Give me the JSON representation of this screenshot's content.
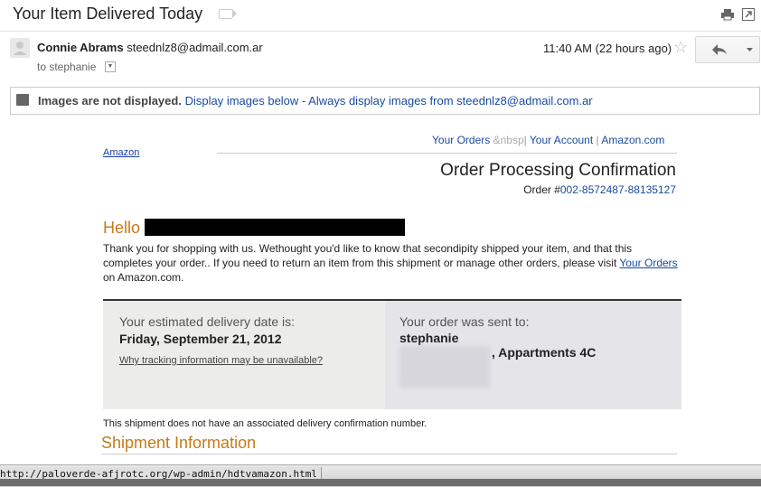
{
  "email": {
    "subject": "Your Item Delivered Today",
    "sender_name": "Connie Abrams",
    "sender_email": "steednlz8@admail.com.ar",
    "to_line": "to stephanie",
    "time": "11:40 AM (22 hours ago)"
  },
  "banner": {
    "bold": "Images are not displayed.",
    "link1": "Display images below",
    "sep": " - ",
    "link2": "Always display images from steednlz8@admail.com.ar"
  },
  "body": {
    "logo_text": "Amazon",
    "nav": {
      "your_orders": "Your Orders",
      "nbsp": "&nbsp",
      "your_account": "Your Account",
      "amazon_com": "Amazon.com"
    },
    "title": "Order Processing Confirmation",
    "order_label": "Order #",
    "order_number": "002-8572487-88135127",
    "hello": "Hello",
    "para_part1": "Thank you for shopping with us. Wethought you'd like to know that secondipity shipped your item, and that this completes your order.. If you need to return an item from this shipment or manage other orders, please visit ",
    "para_link": "Your Orders",
    "para_part2": " on Amazon.com.",
    "delivery_label": "Your estimated delivery date is:",
    "delivery_date": "Friday, September 21, 2012",
    "tracking_link": "Why tracking information may be unavailable?",
    "sent_label": "Your order was sent to:",
    "recipient": "stephanie",
    "address_visible": ", Appartments 4C",
    "note": "This shipment does not have an associated delivery confirmation number.",
    "shipment_heading": "Shipment Information"
  },
  "statusbar": {
    "url": "http://paloverde-afjrotc.org/wp-admin/hdtvamazon.html"
  }
}
